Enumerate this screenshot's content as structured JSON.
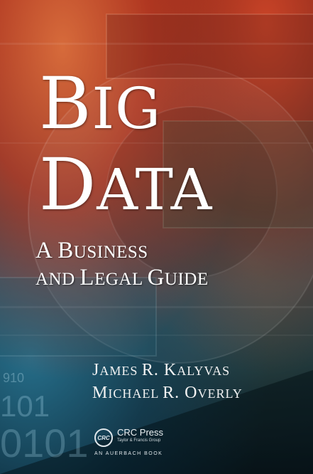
{
  "title": {
    "line1": {
      "cap": "B",
      "rest": "IG"
    },
    "line2": {
      "cap": "D",
      "rest": "ATA"
    }
  },
  "subtitle": {
    "line1": {
      "a": "A B",
      "b": "USINESS"
    },
    "line2": {
      "a": "AND ",
      "b": "L",
      "c": "EGAL ",
      "d": "G",
      "e": "UIDE"
    }
  },
  "authors": [
    {
      "first": "J",
      "first_rest": "AMES ",
      "mid": "R. K",
      "last_rest": "ALYVAS"
    },
    {
      "first": "M",
      "first_rest": "ICHAEL ",
      "mid": "R. O",
      "last_rest": "VERLY"
    }
  ],
  "publisher": {
    "logo_text": "CRC",
    "name": "CRC Press",
    "group": "Taylor & Francis Group",
    "imprint": "AN AUERBACH BOOK"
  },
  "background_digits": [
    "910",
    "101",
    "0101"
  ],
  "colors": {
    "top_accent": "#c9452a",
    "bottom_accent": "#2a6b80",
    "text": "#ffffff"
  }
}
